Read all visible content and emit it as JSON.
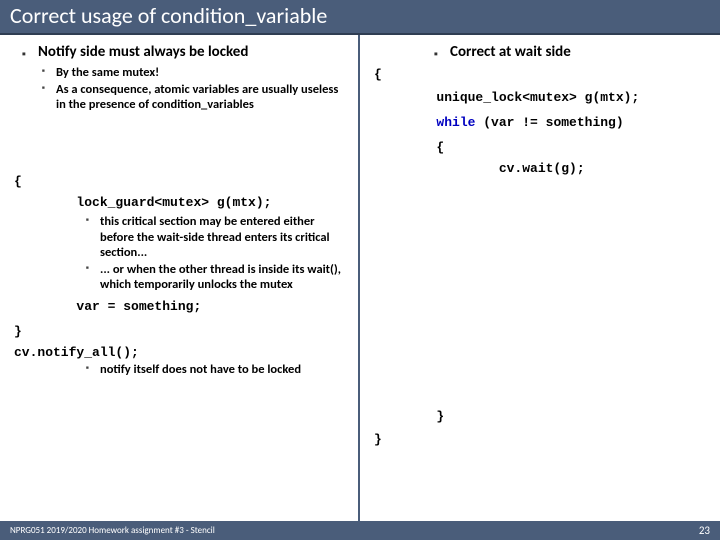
{
  "title": "Correct usage of condition_variable",
  "left": {
    "heading": "Notify side must always be locked",
    "sub1": "By the same mutex!",
    "sub2": "As a consequence, atomic variables are usually useless in the presence of condition_variables",
    "code_open": "{",
    "code_lock": "\tlock_guard<mutex> g(mtx);",
    "note1": "this critical section may be entered either before the wait-side thread enters its critical section...",
    "note2": "... or when the other thread is inside its wait(), which temporarily unlocks the mutex",
    "code_assign": "\tvar = something;",
    "code_close": "}",
    "code_notify": "cv.notify_all();",
    "note3": "notify itself does not have to be locked"
  },
  "right": {
    "heading": "Correct at wait side",
    "c_open": "{",
    "c_lock": "\tunique_lock<mutex> g(mtx);",
    "c_while_a": "\twhile",
    "c_while_b": " (var != something)",
    "c_open2": "\t{",
    "c_wait": "\t\tcv.wait(g);",
    "c_close2": "\t}",
    "c_close": "}"
  },
  "footer": {
    "text": "NPRG051 2019/2020 Homework assignment #3 - Stencil",
    "page": "23"
  }
}
